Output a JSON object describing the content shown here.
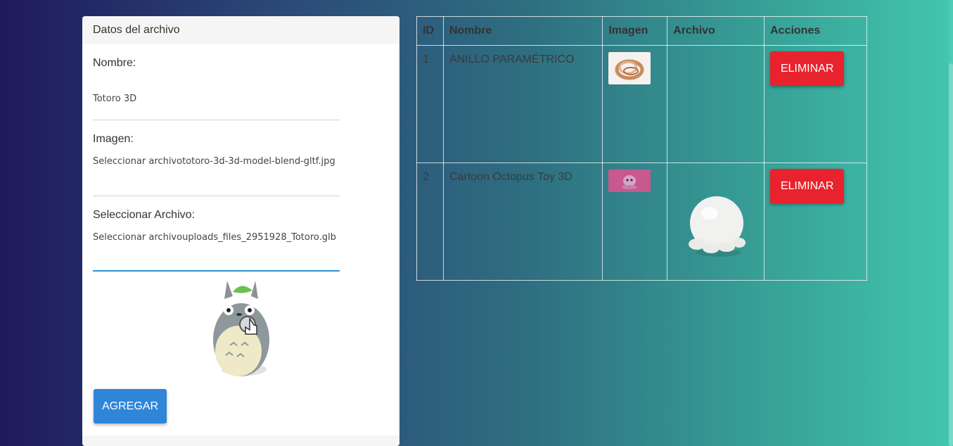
{
  "form": {
    "header": "Datos del archivo",
    "nombre_label": "Nombre:",
    "nombre_value": "Totoro 3D",
    "imagen_label": "Imagen:",
    "imagen_value": "Seleccionar archivototoro-3d-3d-model-blend-gltf.jpg",
    "archivo_label": "Seleccionar Archivo:",
    "archivo_value": "Seleccionar archivouploads_files_2951928_Totoro.glb",
    "submit_label": "AGREGAR"
  },
  "table": {
    "headers": [
      "ID",
      "Nombre",
      "Imagen",
      "Archivo",
      "Acciones"
    ],
    "rows": [
      {
        "id": "1",
        "nombre": "ANILLO PARAMÉTRICO",
        "action": "ELIMINAR"
      },
      {
        "id": "2",
        "nombre": "Cartoon Octopus Toy 3D",
        "action": "ELIMINAR"
      }
    ]
  },
  "colors": {
    "primary_button": "#2f86d9",
    "danger_button": "#e8232d",
    "gradient_start": "#1f1a5c",
    "gradient_end": "#42c6ae"
  }
}
